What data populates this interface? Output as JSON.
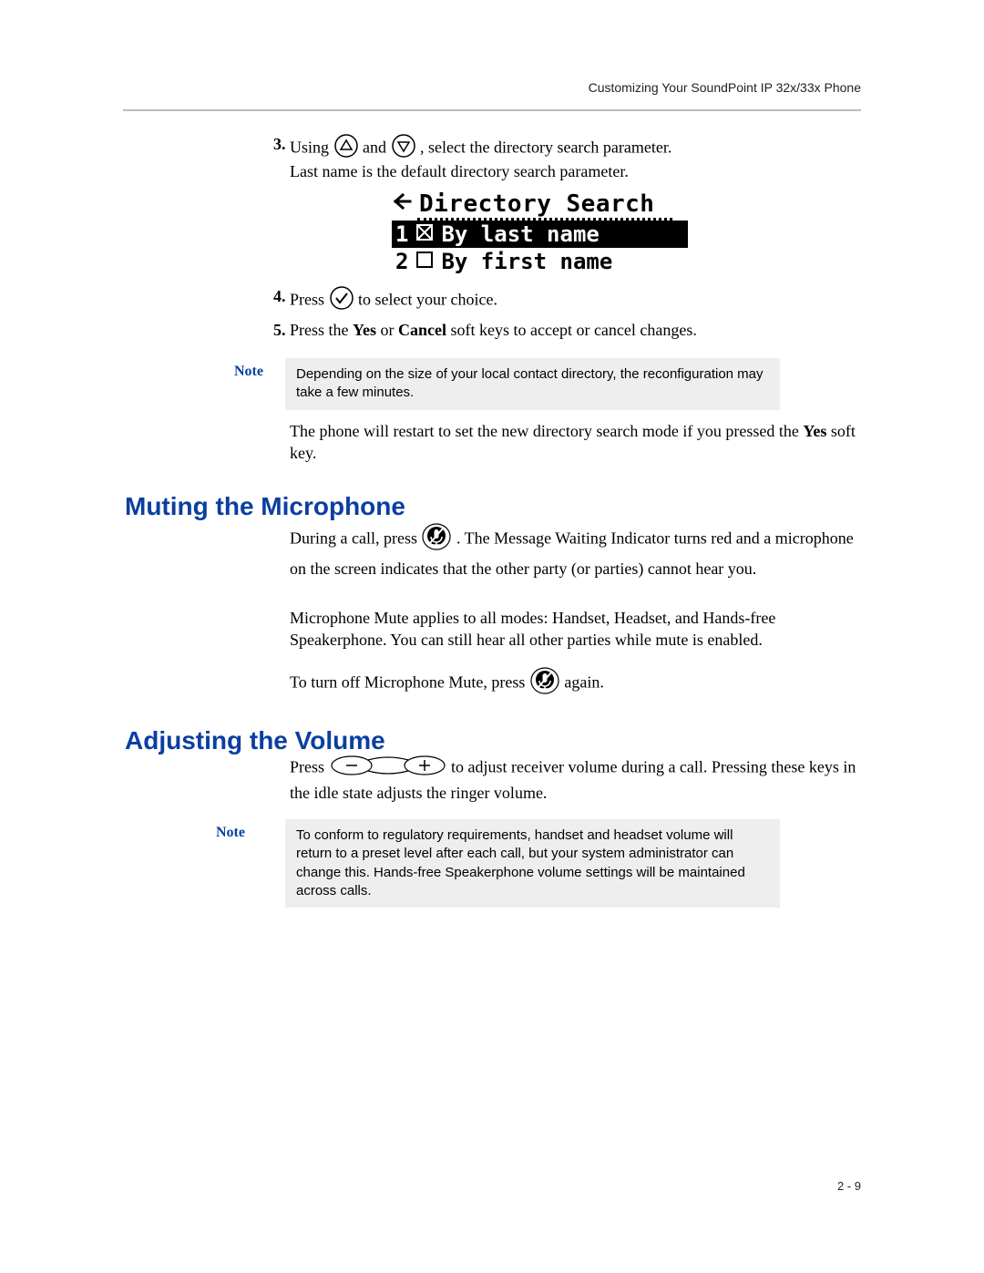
{
  "header": "Customizing Your SoundPoint IP 32x/33x Phone",
  "step3": {
    "num": "3.",
    "pre": "Using ",
    "mid": " and ",
    "post": " , select the directory search parameter.",
    "line2": "Last name is the default directory search parameter."
  },
  "lcd": {
    "title": "Directory Search",
    "row1_num": "1",
    "row1_text": "By last name",
    "row2_num": "2",
    "row2_text": "By first name"
  },
  "step4": {
    "num": "4.",
    "pre": "Press ",
    "post": " to select your choice."
  },
  "step5": {
    "num": "5.",
    "pre": "Press the ",
    "yes": "Yes",
    "or": " or ",
    "cancel": "Cancel",
    "post": " soft keys to accept or cancel changes."
  },
  "note1": {
    "label": "Note",
    "text": "Depending on the size of your local contact directory, the reconfiguration may take a few minutes."
  },
  "restart": {
    "line1": "The phone will restart to set the new directory search mode if you pressed the ",
    "yes": "Yes",
    "post": " soft key."
  },
  "muting": {
    "title": "Muting the Microphone",
    "p1_pre": "During a call, press ",
    "p1_post": " . The Message Waiting Indicator turns red and a microphone on the screen indicates that the other party (or parties) cannot hear you.",
    "p2": "Microphone Mute applies to all modes: Handset, Headset, and Hands-free Speakerphone. You can still hear all other parties while mute is enabled.",
    "p3_pre": "To turn off Microphone Mute, press ",
    "p3_post": " again."
  },
  "volume": {
    "title": "Adjusting the Volume",
    "p_pre": "Press ",
    "p_post": " to adjust receiver volume during a call. Pressing these keys in the idle state adjusts the ringer volume."
  },
  "note2": {
    "label": "Note",
    "text": "To conform to regulatory requirements, handset and headset volume will return to a preset level after each call, but your system administrator can change this. Hands-free Speakerphone volume settings will be maintained across calls."
  },
  "footer": "2 - 9"
}
